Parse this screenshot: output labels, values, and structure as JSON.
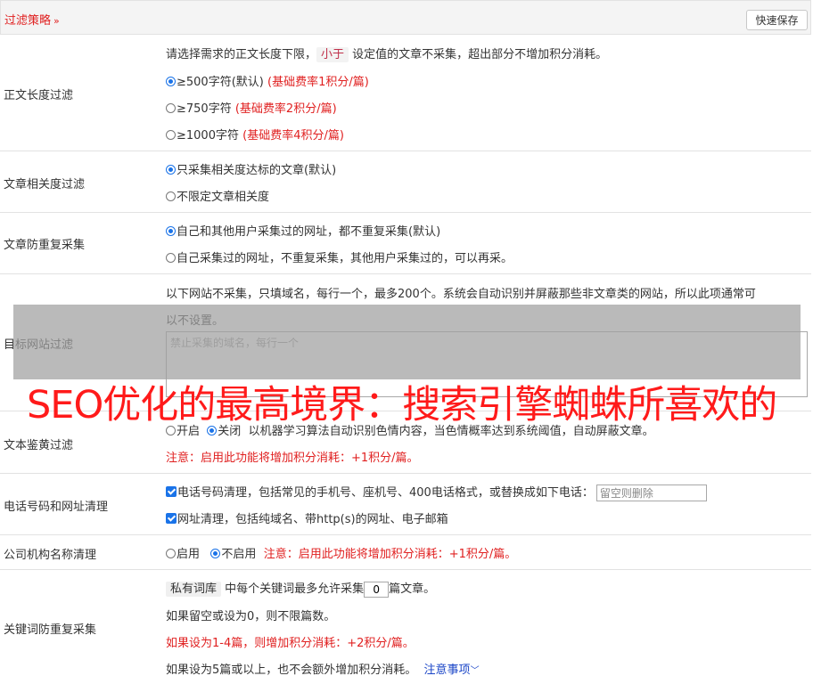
{
  "header": {
    "title": "过滤策略",
    "chevron": "»",
    "save_label": "快速保存"
  },
  "length_filter": {
    "label": "正文长度过滤",
    "desc_prefix": "请选择需求的正文长度下限，",
    "desc_tag": "小于",
    "desc_suffix": " 设定值的文章不采集，超出部分不增加积分消耗。",
    "options": [
      {
        "label": "≥500字符(默认)",
        "note": "(基础费率1积分/篇)",
        "selected": true
      },
      {
        "label": "≥750字符",
        "note": "(基础费率2积分/篇)",
        "selected": false
      },
      {
        "label": "≥1000字符",
        "note": "(基础费率4积分/篇)",
        "selected": false
      }
    ]
  },
  "relevance": {
    "label": "文章相关度过滤",
    "options": [
      {
        "label": "只采集相关度达标的文章(默认)",
        "selected": true
      },
      {
        "label": "不限定文章相关度",
        "selected": false
      }
    ]
  },
  "dedupe": {
    "label": "文章防重复采集",
    "options": [
      {
        "label": "自己和其他用户采集过的网址，都不重复采集(默认)",
        "selected": true
      },
      {
        "label": "自己采集过的网址，不重复采集，其他用户采集过的，可以再采。",
        "selected": false
      }
    ]
  },
  "site_filter": {
    "label": "目标网站过滤",
    "desc_line1": "以下网站不采集，只填域名，每行一个，最多200个。系统会自动识别并屏蔽那些非文章类的网站，所以此项通常可",
    "desc_line2": "以不设置。",
    "placeholder": "禁止采集的域名，每行一个"
  },
  "watermark": {
    "text": "SEO优化的最高境界：搜索引擎蜘蛛所喜欢的"
  },
  "porn_filter": {
    "label": "文本鉴黄过滤",
    "on_label": "开启",
    "off_label": "关闭",
    "desc": "以机器学习算法自动识别色情内容，当色情概率达到系统阈值，自动屏蔽文章。",
    "note": "注意：启用此功能将增加积分消耗：+1积分/篇。"
  },
  "phone_clean": {
    "label": "电话号码和网址清理",
    "phone_label": "电话号码清理，包括常见的手机号、座机号、400电话格式，或替换成如下电话：",
    "phone_placeholder": "留空则删除",
    "url_label": "网址清理，包括纯域名、带http(s)的网址、电子邮箱"
  },
  "company_clean": {
    "label": "公司机构名称清理",
    "on_label": "启用",
    "off_label": "不启用",
    "note": "注意：启用此功能将增加积分消耗：+1积分/篇。"
  },
  "keyword_dedupe": {
    "label": "关键词防重复采集",
    "tag": "私有词库",
    "text_before": " 中每个关键词最多允许采集",
    "value": "0",
    "text_after": "篇文章。",
    "line2": "如果留空或设为0，则不限篇数。",
    "line3": "如果设为1-4篇，则增加积分消耗：+2积分/篇。",
    "line4": "如果设为5篇或以上，也不会额外增加积分消耗。",
    "notice_link": "注意事项"
  }
}
